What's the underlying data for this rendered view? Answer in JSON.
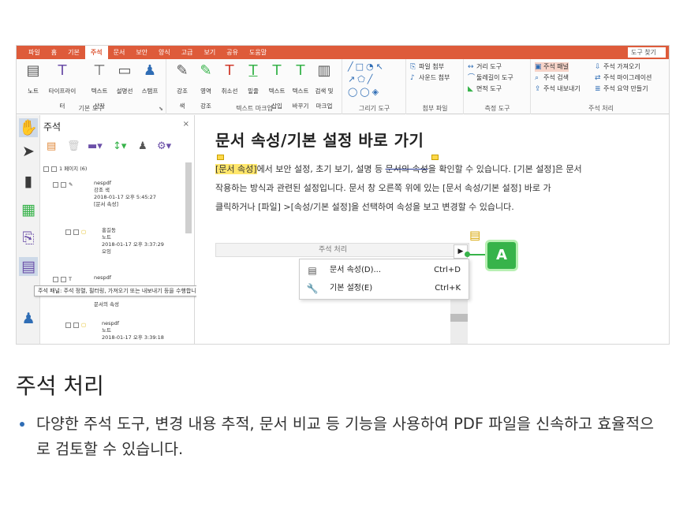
{
  "ribbon": {
    "tabs": [
      "파일",
      "홈",
      "기본",
      "주석",
      "문서",
      "보안",
      "양식",
      "고급",
      "보기",
      "공유",
      "도움말"
    ],
    "active_tab_index": 3,
    "find_label": "도구 찾기",
    "groups": {
      "basic": {
        "label": "기본 도구",
        "buttons": [
          "노트",
          "타이프라이터",
          "텍스트\n상자",
          "설명선",
          "스탬프"
        ]
      },
      "text_markup": {
        "label": "텍스트 마크업",
        "buttons": [
          "강조\n색",
          "영역\n강조",
          "취소선",
          "밑줄",
          "텍스트\n삽입",
          "텍스트\n바꾸기",
          "검색 및\n마크업"
        ]
      },
      "drawing": {
        "label": "그리기 도구"
      },
      "attach": {
        "label": "첨부 파일",
        "items": [
          "파일 첨부",
          "사운드 첨부"
        ]
      },
      "measure": {
        "label": "측정 도구",
        "items": [
          "거리 도구",
          "둘레길이 도구",
          "면적 도구"
        ]
      },
      "annot": {
        "label": "주석 처리",
        "items": [
          "주석 패널",
          "주석 검색",
          "주석 내보내기",
          "주석 가져오기",
          "주석 마이그레이션",
          "주석 요약 만들기"
        ]
      }
    }
  },
  "panel": {
    "title": "주석",
    "close": "×",
    "page_node": "1 페이지 (6)",
    "items": [
      {
        "author": "nespdf",
        "type": "강조 색",
        "date": "2018-01-17 오후 5:45:27",
        "content": "[문서 속성]"
      },
      {
        "author": "홍길동",
        "type": "노트",
        "date": "2018-01-17 오후 3:37:29",
        "content": "오잉"
      },
      {
        "author": "nespdf",
        "type": "",
        "date": "",
        "content": "문서의 속성"
      },
      {
        "author": "nespdf",
        "type": "노트",
        "date": "2018-01-17 오후 3:39:18",
        "content": ""
      }
    ],
    "tooltip": "주석 패널: 주석 정렬, 필터링, 가져오기 또는 내보내기 등을 수행합니다."
  },
  "document": {
    "title": "문서 속성/기본 설정 바로 가기",
    "p1_hl": "[문서 속성]",
    "p1_a": "에서 보안 설정, 초기 보기, 설명 등 ",
    "p1_strike": "문서의 속성",
    "p1_b": "을 확인할 수 있습니다. [기본 설정]은 문서",
    "p2": "작용하는 방식과 관련된 설정입니다. 문서 창 오른쪽 위에 있는 [문서 속성/기본 설정] 바로 가",
    "p3": "클릭하거나 [파일] >[속성/기본 설정]을 선택하여 속성을 보고 변경할 수 있습니다.",
    "strip_label": "주석 처리",
    "menu": [
      {
        "label": "문서 속성(D)...",
        "shortcut": "Ctrl+D"
      },
      {
        "label": "기본 설정(E)",
        "shortcut": "Ctrl+K"
      }
    ],
    "callout": "A"
  },
  "section": {
    "heading": "주석 처리",
    "bullet": "다양한 주석 도구, 변경 내용 추적, 문서 비교 등 기능을 사용하여 PDF 파일을 신속하고 효율적으로 검토할 수 있습니다."
  },
  "colors": {
    "ribbon_accent": "#de5b3a",
    "highlight": "#ffe66b",
    "callout_green": "#37b34a",
    "bullet_blue": "#2f6db5"
  }
}
